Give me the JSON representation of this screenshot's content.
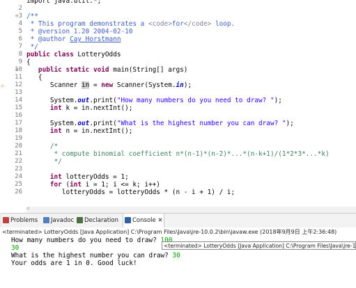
{
  "editor": {
    "lines": [
      {
        "n": "",
        "segs": [
          {
            "t": "import java.util.*;",
            "c": "kw-partial"
          }
        ]
      },
      {
        "n": "2",
        "segs": []
      },
      {
        "n": "3",
        "fold": "⊖",
        "segs": [
          {
            "t": "/**",
            "c": "jd"
          }
        ]
      },
      {
        "n": "4",
        "segs": [
          {
            "t": " * This program demonstrates a ",
            "c": "jd"
          },
          {
            "t": "<code>",
            "c": "tag"
          },
          {
            "t": "for",
            "c": "jd"
          },
          {
            "t": "</code>",
            "c": "tag"
          },
          {
            "t": " loop.",
            "c": "jd"
          }
        ]
      },
      {
        "n": "5",
        "segs": [
          {
            "t": " * @version 1.20 2004-02-10",
            "c": "jd"
          }
        ]
      },
      {
        "n": "6",
        "segs": [
          {
            "t": " * @author ",
            "c": "jd"
          },
          {
            "t": "Cay Horstmann",
            "c": "jd u"
          }
        ]
      },
      {
        "n": "7",
        "segs": [
          {
            "t": " */",
            "c": "jd"
          }
        ]
      },
      {
        "n": "8",
        "segs": [
          {
            "t": "public ",
            "c": "kw"
          },
          {
            "t": "class ",
            "c": "kw"
          },
          {
            "t": "LotteryOdds",
            "c": ""
          }
        ]
      },
      {
        "n": "9",
        "segs": [
          {
            "t": "{",
            "c": ""
          }
        ]
      },
      {
        "n": "10",
        "fold": "⊖",
        "segs": [
          {
            "t": "   public ",
            "c": "kw"
          },
          {
            "t": "static ",
            "c": "kw"
          },
          {
            "t": "void ",
            "c": "kw"
          },
          {
            "t": "main(String[] args)",
            "c": ""
          }
        ]
      },
      {
        "n": "11",
        "segs": [
          {
            "t": "   {",
            "c": ""
          }
        ]
      },
      {
        "n": "12",
        "marker": "⚠",
        "segs": [
          {
            "t": "      Scanner ",
            "c": ""
          },
          {
            "t": "in",
            "c": "hl"
          },
          {
            "t": " = ",
            "c": ""
          },
          {
            "t": "new ",
            "c": "kw"
          },
          {
            "t": "Scanner(System.",
            "c": ""
          },
          {
            "t": "in",
            "c": "fld"
          },
          {
            "t": ");",
            "c": ""
          }
        ]
      },
      {
        "n": "13",
        "segs": []
      },
      {
        "n": "14",
        "segs": [
          {
            "t": "      System.",
            "c": ""
          },
          {
            "t": "out",
            "c": "fld"
          },
          {
            "t": ".print(",
            "c": ""
          },
          {
            "t": "\"How many numbers do you need to draw? \"",
            "c": "str"
          },
          {
            "t": ");",
            "c": ""
          }
        ]
      },
      {
        "n": "15",
        "segs": [
          {
            "t": "      ",
            "c": ""
          },
          {
            "t": "int ",
            "c": "kw"
          },
          {
            "t": "k = ",
            "c": ""
          },
          {
            "t": "in",
            "c": ""
          },
          {
            "t": ".nextInt();",
            "c": ""
          }
        ]
      },
      {
        "n": "16",
        "segs": []
      },
      {
        "n": "17",
        "segs": [
          {
            "t": "      System.",
            "c": ""
          },
          {
            "t": "out",
            "c": "fld"
          },
          {
            "t": ".print(",
            "c": ""
          },
          {
            "t": "\"What is the highest number you can draw? \"",
            "c": "str"
          },
          {
            "t": ");",
            "c": ""
          }
        ]
      },
      {
        "n": "18",
        "segs": [
          {
            "t": "      ",
            "c": ""
          },
          {
            "t": "int ",
            "c": "kw"
          },
          {
            "t": "n = ",
            "c": ""
          },
          {
            "t": "in",
            "c": ""
          },
          {
            "t": ".nextInt();",
            "c": ""
          }
        ]
      },
      {
        "n": "19",
        "segs": []
      },
      {
        "n": "20",
        "segs": [
          {
            "t": "      /*",
            "c": "cm"
          }
        ]
      },
      {
        "n": "21",
        "segs": [
          {
            "t": "       * compute binomial coefficient n*(n-1)*(n-2)*...*(n-k+1)/(1*2*3*...*k)",
            "c": "cm"
          }
        ]
      },
      {
        "n": "22",
        "segs": [
          {
            "t": "       */",
            "c": "cm"
          }
        ]
      },
      {
        "n": "23",
        "segs": []
      },
      {
        "n": "24",
        "segs": [
          {
            "t": "      ",
            "c": ""
          },
          {
            "t": "int ",
            "c": "kw"
          },
          {
            "t": "lotteryOdds = 1;",
            "c": ""
          }
        ]
      },
      {
        "n": "25",
        "segs": [
          {
            "t": "      ",
            "c": ""
          },
          {
            "t": "for ",
            "c": "kw"
          },
          {
            "t": "(",
            "c": ""
          },
          {
            "t": "int ",
            "c": "kw"
          },
          {
            "t": "i = 1; i <= k; i++)",
            "c": ""
          }
        ]
      },
      {
        "n": "26",
        "segs": [
          {
            "t": "         lotteryOdds = lotteryOdds * (n - i + 1) / i;",
            "c": ""
          }
        ]
      }
    ],
    "scroll_glyph": "<"
  },
  "tabs": [
    {
      "name": "tab-problems",
      "label": "Problems",
      "color": "#c04040"
    },
    {
      "name": "tab-javadoc",
      "label": "Javadoc",
      "color": "#5080c0"
    },
    {
      "name": "tab-declaration",
      "label": "Declaration",
      "color": "#4a7040"
    },
    {
      "name": "tab-console",
      "label": "Console",
      "color": "#3060a0",
      "suffix": " ✕"
    }
  ],
  "console": {
    "status": "<terminated> LotteryOdds [Java Application] C:\\Program Files\\Java\\jre-10.0.2\\bin\\javaw.exe (2018年9月9日 上午2:36:48)",
    "line1_prompt": "How many numbers do you need to draw? ",
    "line1_input": "100",
    "line2_input": "30",
    "line3_prompt": "What is the highest number you can draw? ",
    "line3_input": "30",
    "line4": "Your odds are 1 in 0. Good luck!",
    "tooltip": "<terminated> LotteryOdds [Java Application] C:\\Program Files\\Java\\jre-1"
  }
}
